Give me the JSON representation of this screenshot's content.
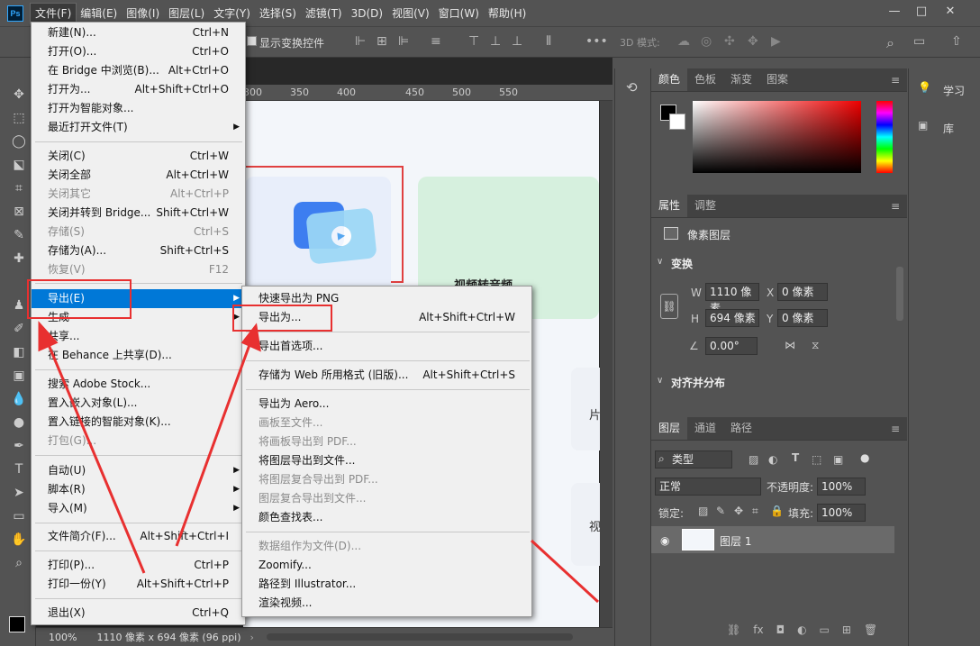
{
  "menubar": {
    "logo": "Ps",
    "items": [
      "文件(F)",
      "编辑(E)",
      "图像(I)",
      "图层(L)",
      "文字(Y)",
      "选择(S)",
      "滤镜(T)",
      "3D(D)",
      "视图(V)",
      "窗口(W)",
      "帮助(H)"
    ]
  },
  "window_controls": {
    "minimize": "—",
    "maximize": "□",
    "close": "✕"
  },
  "options": {
    "transform_label": "显示变换控件",
    "mode3d": "3D 模式:"
  },
  "ruler": {
    "ticks": [
      "300",
      "350",
      "400",
      "450",
      "500",
      "550"
    ]
  },
  "canvas": {
    "card_text": "视频转音频",
    "side1": "片",
    "side2": "视"
  },
  "status": {
    "zoom": "100%",
    "docinfo": "1110 像素 x 694 像素 (96 ppi)"
  },
  "file_menu": {
    "items": [
      {
        "label": "新建(N)...",
        "shortcut": "Ctrl+N"
      },
      {
        "label": "打开(O)...",
        "shortcut": "Ctrl+O"
      },
      {
        "label": "在 Bridge 中浏览(B)...",
        "shortcut": "Alt+Ctrl+O"
      },
      {
        "label": "打开为...",
        "shortcut": "Alt+Shift+Ctrl+O"
      },
      {
        "label": "打开为智能对象...",
        "shortcut": ""
      },
      {
        "label": "最近打开文件(T)",
        "shortcut": ""
      },
      {
        "label": "关闭(C)",
        "shortcut": "Ctrl+W"
      },
      {
        "label": "关闭全部",
        "shortcut": "Alt+Ctrl+W"
      },
      {
        "label": "关闭其它",
        "shortcut": "Alt+Ctrl+P"
      },
      {
        "label": "关闭并转到 Bridge...",
        "shortcut": "Shift+Ctrl+W"
      },
      {
        "label": "存储(S)",
        "shortcut": "Ctrl+S"
      },
      {
        "label": "存储为(A)...",
        "shortcut": "Shift+Ctrl+S"
      },
      {
        "label": "恢复(V)",
        "shortcut": "F12"
      },
      {
        "label": "导出(E)",
        "shortcut": ""
      },
      {
        "label": "生成",
        "shortcut": ""
      },
      {
        "label": "共享...",
        "shortcut": ""
      },
      {
        "label": "在 Behance 上共享(D)...",
        "shortcut": ""
      },
      {
        "label": "搜索 Adobe Stock...",
        "shortcut": ""
      },
      {
        "label": "置入嵌入对象(L)...",
        "shortcut": ""
      },
      {
        "label": "置入链接的智能对象(K)...",
        "shortcut": ""
      },
      {
        "label": "打包(G)...",
        "shortcut": ""
      },
      {
        "label": "自动(U)",
        "shortcut": ""
      },
      {
        "label": "脚本(R)",
        "shortcut": ""
      },
      {
        "label": "导入(M)",
        "shortcut": ""
      },
      {
        "label": "文件简介(F)...",
        "shortcut": "Alt+Shift+Ctrl+I"
      },
      {
        "label": "打印(P)...",
        "shortcut": "Ctrl+P"
      },
      {
        "label": "打印一份(Y)",
        "shortcut": "Alt+Shift+Ctrl+P"
      },
      {
        "label": "退出(X)",
        "shortcut": "Ctrl+Q"
      }
    ]
  },
  "export_menu": {
    "items": [
      {
        "label": "快速导出为 PNG",
        "shortcut": ""
      },
      {
        "label": "导出为...",
        "shortcut": "Alt+Shift+Ctrl+W"
      },
      {
        "label": "导出首选项...",
        "shortcut": ""
      },
      {
        "label": "存储为 Web 所用格式 (旧版)...",
        "shortcut": "Alt+Shift+Ctrl+S"
      },
      {
        "label": "导出为 Aero...",
        "shortcut": ""
      },
      {
        "label": "画板至文件...",
        "shortcut": ""
      },
      {
        "label": "将画板导出到 PDF...",
        "shortcut": ""
      },
      {
        "label": "将图层导出到文件...",
        "shortcut": ""
      },
      {
        "label": "将图层复合导出到 PDF...",
        "shortcut": ""
      },
      {
        "label": "图层复合导出到文件...",
        "shortcut": ""
      },
      {
        "label": "颜色查找表...",
        "shortcut": ""
      },
      {
        "label": "数据组作为文件(D)...",
        "shortcut": ""
      },
      {
        "label": "Zoomify...",
        "shortcut": ""
      },
      {
        "label": "路径到 Illustrator...",
        "shortcut": ""
      },
      {
        "label": "渲染视频...",
        "shortcut": ""
      }
    ]
  },
  "color_panel": {
    "tabs": [
      "颜色",
      "色板",
      "渐变",
      "图案"
    ]
  },
  "props_panel": {
    "tabs": [
      "属性",
      "调整"
    ],
    "layer_type": "像素图层",
    "transform_title": "变换",
    "w_label": "W",
    "w": "1110 像素",
    "x_label": "X",
    "x": "0 像素",
    "h_label": "H",
    "h": "694 像素",
    "y_label": "Y",
    "y": "0 像素",
    "angle": "0.00°",
    "align_title": "对齐并分布"
  },
  "layers_panel": {
    "tabs": [
      "图层",
      "通道",
      "路径"
    ],
    "filter": "类型",
    "blend": "正常",
    "opacity_label": "不透明度:",
    "opacity": "100%",
    "lock_label": "锁定:",
    "fill_label": "填充:",
    "fill": "100%",
    "layer_name": "图层 1"
  },
  "far_right": {
    "learn": "学习",
    "library": "库"
  },
  "colors": {
    "accent": "#0078d7",
    "red_annotation": "#e83030",
    "canvas_green": "#d6f0de"
  }
}
